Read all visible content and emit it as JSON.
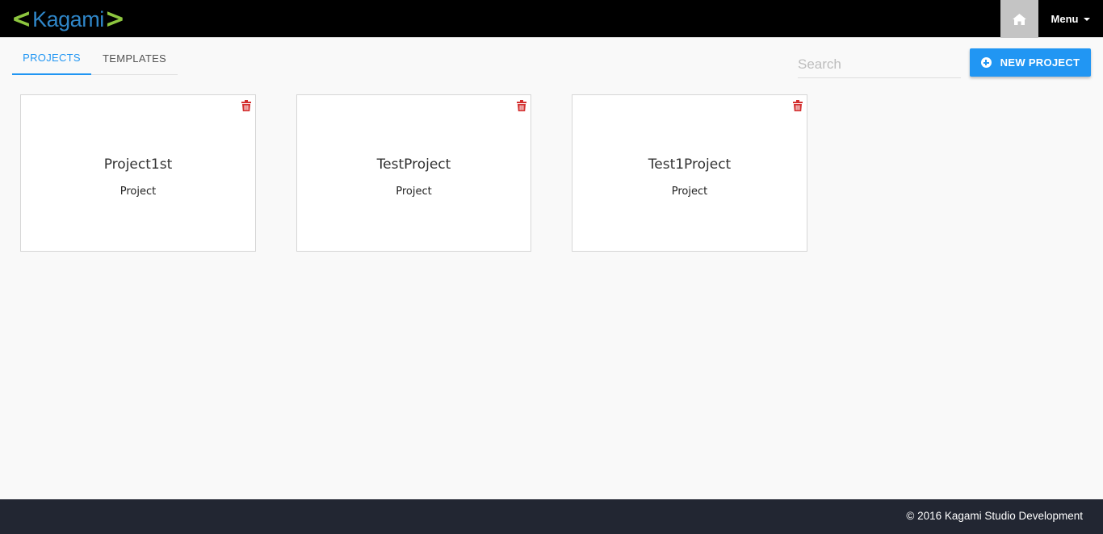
{
  "header": {
    "logo_left": "<",
    "logo_text": "Kagami",
    "logo_right": ">",
    "home_icon": "home-icon",
    "menu_label": "Menu",
    "colors": {
      "bar": "#000000",
      "home_bg": "#c4c4c4",
      "logo_bracket": "#8dc63f",
      "logo_text": "#2f86c8"
    }
  },
  "tabs": [
    {
      "label": "PROJECTS",
      "active": true
    },
    {
      "label": "TEMPLATES",
      "active": false
    }
  ],
  "search": {
    "placeholder": "Search",
    "value": ""
  },
  "new_project": {
    "label": "NEW PROJECT",
    "icon": "plus-circle-icon",
    "color": "#2196f3"
  },
  "projects": [
    {
      "name": "Project1st",
      "type": "Project"
    },
    {
      "name": "TestProject",
      "type": "Project"
    },
    {
      "name": "Test1Project",
      "type": "Project"
    }
  ],
  "delete_icon_color": "#d32f2f",
  "footer": {
    "copyright": "© 2016 Kagami Studio Development",
    "bg": "#222632"
  }
}
